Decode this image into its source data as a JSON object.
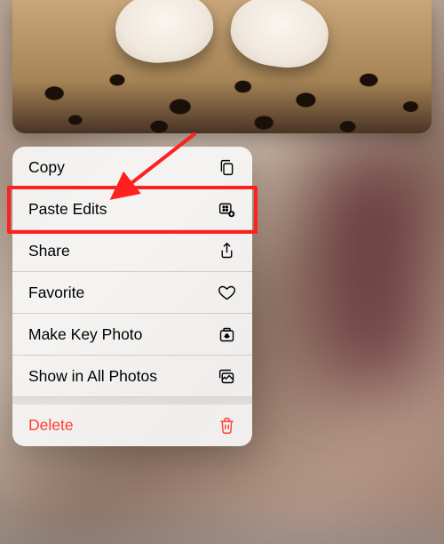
{
  "menu": {
    "items": [
      {
        "label": "Copy",
        "icon": "copy-icon",
        "destructive": false
      },
      {
        "label": "Paste Edits",
        "icon": "paste-edits-icon",
        "destructive": false
      },
      {
        "label": "Share",
        "icon": "share-icon",
        "destructive": false
      },
      {
        "label": "Favorite",
        "icon": "heart-icon",
        "destructive": false
      },
      {
        "label": "Make Key Photo",
        "icon": "key-photo-icon",
        "destructive": false
      },
      {
        "label": "Show in All Photos",
        "icon": "all-photos-icon",
        "destructive": false
      },
      {
        "label": "Delete",
        "icon": "trash-icon",
        "destructive": true
      }
    ]
  },
  "annotation": {
    "highlighted_item": "Paste Edits",
    "arrow_color": "#ff2020"
  }
}
